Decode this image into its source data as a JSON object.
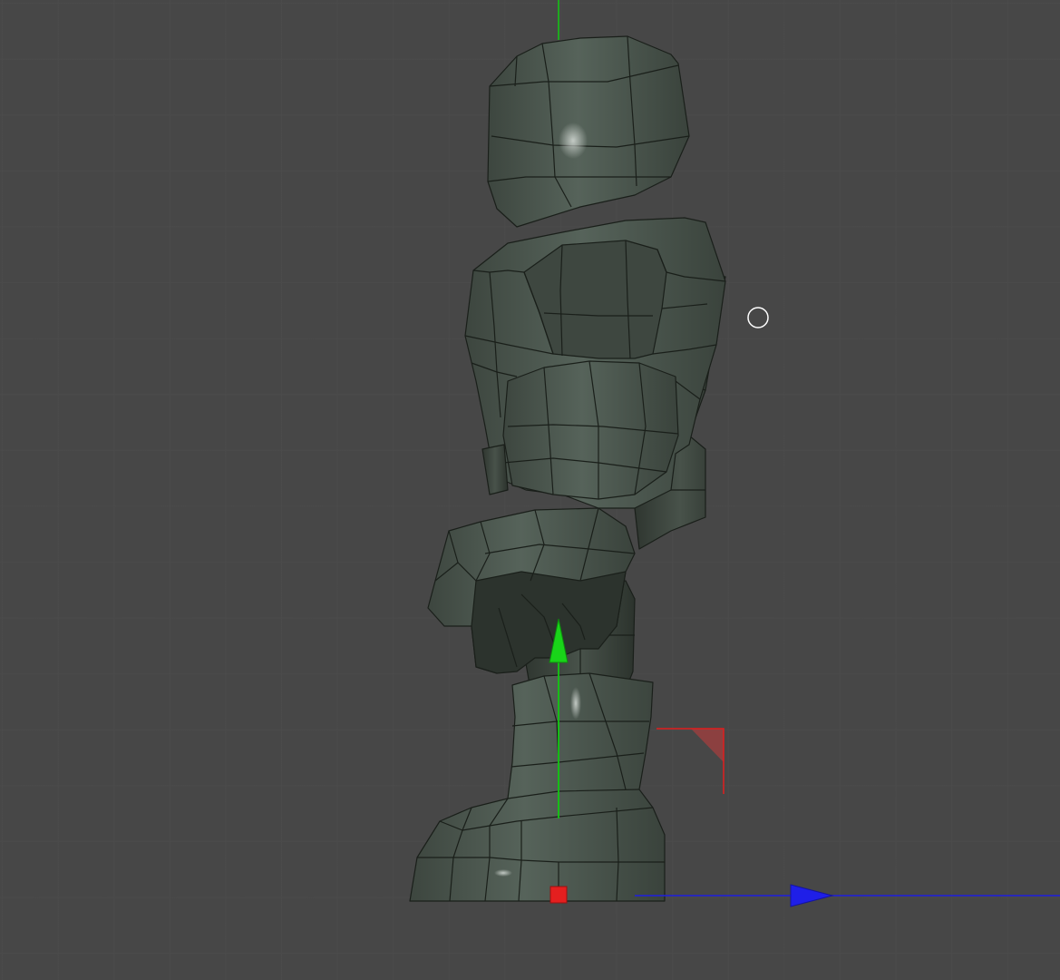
{
  "viewport": {
    "label": "3D viewport - side view",
    "background_color": "#474747",
    "grid_line_color": "#4b4b4b"
  },
  "model": {
    "name": "low-poly character mesh",
    "fill_color": "#4e5a4f",
    "edge_color": "#1a1f1a",
    "highlight_color": "#a9b3ab"
  },
  "gizmo": {
    "y_axis_color": "#12c812",
    "z_axis_color": "#1f1fe0",
    "x_axis_color": "#e01e1e",
    "pivot_color": "#e41f1f"
  },
  "cursor": {
    "icon": "circle-cursor-icon",
    "color": "#ffffff"
  }
}
